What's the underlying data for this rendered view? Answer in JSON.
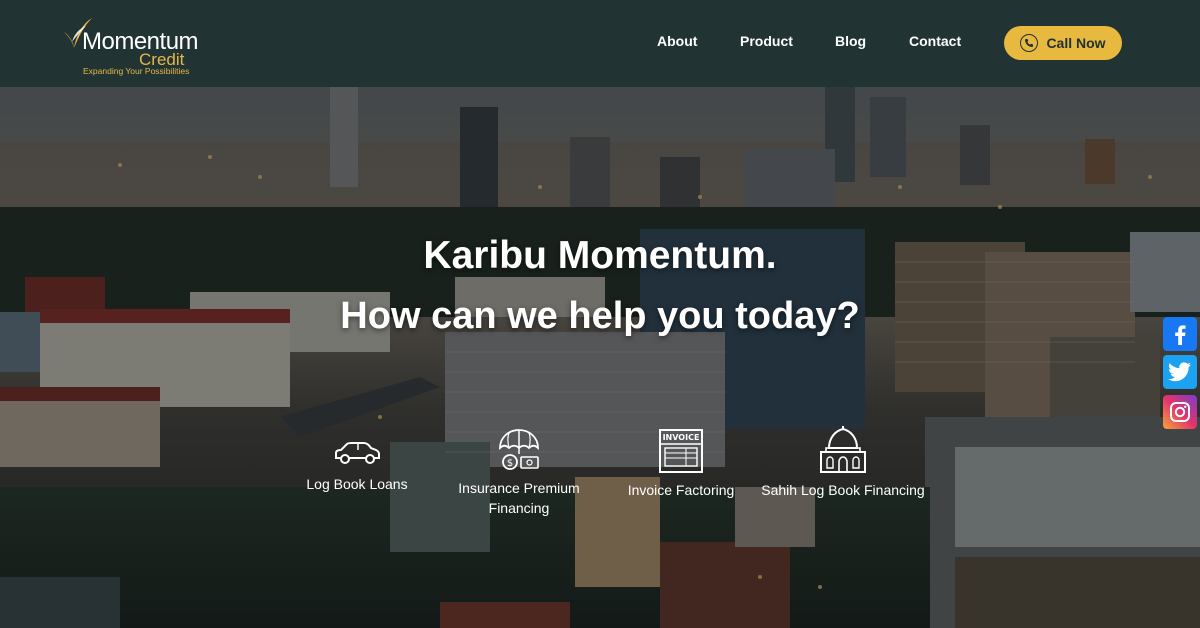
{
  "header": {
    "logo": {
      "name": "Momentum",
      "sub": "Credit",
      "tagline": "Expanding Your Possibilities"
    },
    "nav": [
      "About",
      "Product",
      "Blog",
      "Contact"
    ],
    "cta": "Call Now"
  },
  "hero": {
    "line1": "Karibu Momentum.",
    "line2": "How can we help you today?",
    "services": [
      {
        "label": "Log Book Loans",
        "icon": "car-icon"
      },
      {
        "label": "Insurance Premium Financing",
        "icon": "umbrella-money-icon"
      },
      {
        "label": "Invoice Factoring",
        "icon": "invoice-icon"
      },
      {
        "label": "Sahih Log Book Financing",
        "icon": "mosque-icon"
      }
    ]
  },
  "social": [
    {
      "name": "facebook-icon",
      "color": "#1877f2"
    },
    {
      "name": "twitter-icon",
      "color": "#1da1f2"
    },
    {
      "name": "instagram-icon",
      "color": "#d62976"
    }
  ],
  "colors": {
    "header_bg": "#213433",
    "accent": "#e8b93f"
  }
}
